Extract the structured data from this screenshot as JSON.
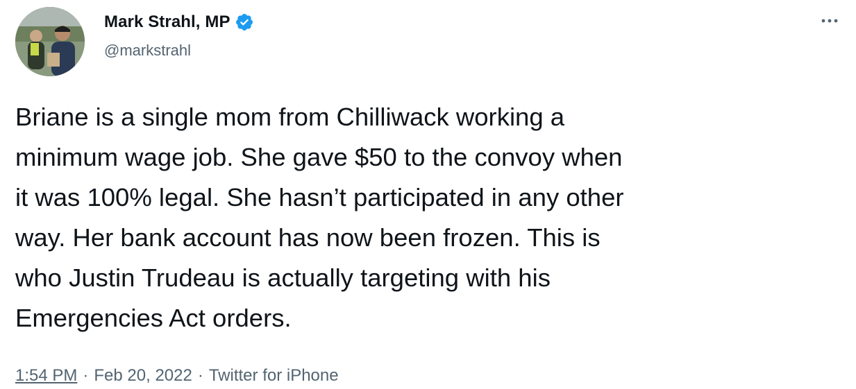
{
  "author": {
    "display_name": "Mark Strahl, MP",
    "handle": "@markstrahl",
    "verified": true,
    "avatar_icon": "profile-photo"
  },
  "tweet": {
    "text": "Briane is a single mom from Chilliwack working a\nminimum wage job. She gave $50 to the convoy when\nit was 100% legal. She hasn’t participated in any other\nway. Her bank account has now been frozen. This is\nwho Justin Trudeau is actually targeting with his\nEmergencies Act orders."
  },
  "meta": {
    "time": "1:54 PM",
    "separator": "·",
    "date": "Feb 20, 2022",
    "source": "Twitter for iPhone"
  },
  "icons": {
    "verified": "verified-badge-icon",
    "more": "more-options-icon"
  },
  "colors": {
    "text_primary": "#0f1419",
    "text_secondary": "#536471",
    "verified_blue": "#1d9bf0"
  }
}
